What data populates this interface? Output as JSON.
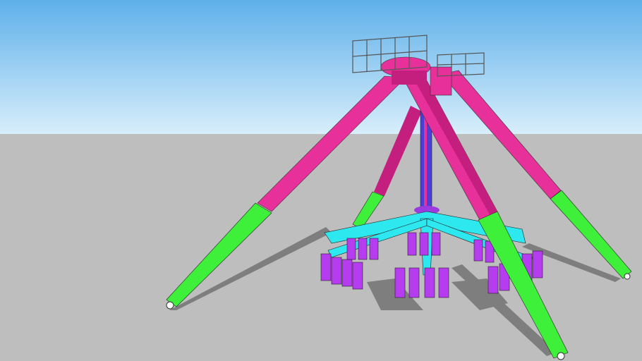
{
  "scene": {
    "sky_top": "#5eb0ea",
    "sky_horizon": "#d8eefb",
    "ground": "#bebebe",
    "shadow": "#6e6e6e",
    "arm_pink": "#e8309a",
    "arm_pink_dark": "#c41f7e",
    "leg_green": "#3ff03a",
    "column_blue": "#4a3fd8",
    "star_cyan": "#2ee8f0",
    "seat_purple": "#b63cf0",
    "platform_gray": "#8a8a8a"
  }
}
